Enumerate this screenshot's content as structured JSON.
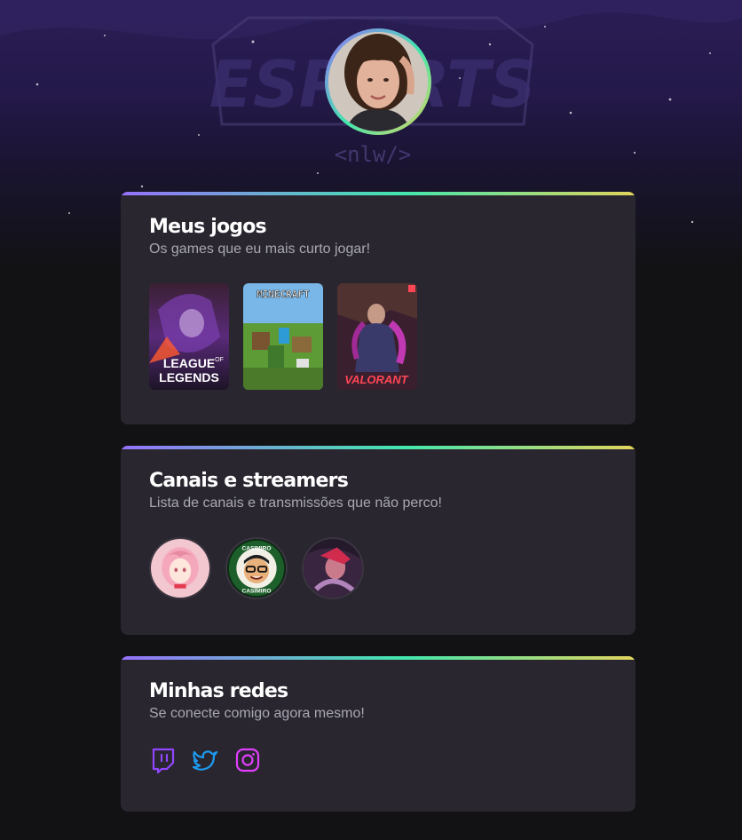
{
  "hero": {
    "logo_text": "ESPORTS",
    "logo_tag": "<nlw/>"
  },
  "profile": {
    "avatar": "user-avatar-photo"
  },
  "games_card": {
    "title": "Meus jogos",
    "subtitle": "Os games que eu mais curto jogar!",
    "games": [
      {
        "name": "league-of-legends",
        "label_line1": "LEAGUE",
        "label_of": "OF",
        "label_line2": "LEGENDS",
        "color": "#6b2fa8"
      },
      {
        "name": "minecraft",
        "label": "MINECRAFT",
        "color": "#4a8a2a"
      },
      {
        "name": "valorant",
        "label": "VALORANT",
        "color": "#ff4655"
      }
    ]
  },
  "streamers_card": {
    "title": "Canais e streamers",
    "subtitle": "Lista de canais e transmissões que não perco!",
    "streamers": [
      {
        "name": "streamer-anime-avatar"
      },
      {
        "name": "streamer-casimiro",
        "ring_text_top": "CASIMIRO",
        "ring_text_bottom": "CASIMIRO"
      },
      {
        "name": "streamer-lol-avatar"
      }
    ]
  },
  "social_card": {
    "title": "Minhas redes",
    "subtitle": "Se conecte comigo agora mesmo!",
    "links": [
      {
        "icon": "twitch-icon",
        "color": "#9146ff"
      },
      {
        "icon": "twitter-icon",
        "color": "#1d9bf0"
      },
      {
        "icon": "instagram-icon",
        "color": "#e040fb"
      }
    ]
  }
}
